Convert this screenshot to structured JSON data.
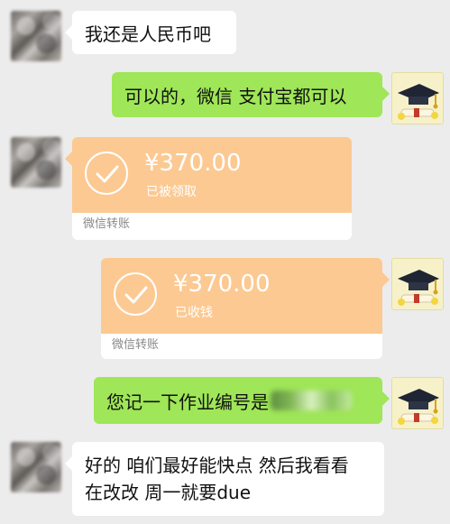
{
  "messages": [
    {
      "side": "left",
      "type": "text",
      "text": "我还是人民币吧"
    },
    {
      "side": "right",
      "type": "text",
      "text": "可以的，微信 支付宝都可以"
    },
    {
      "side": "left",
      "type": "transfer",
      "amount": "¥370.00",
      "status": "已被领取",
      "footer": "微信转账"
    },
    {
      "side": "right",
      "type": "transfer",
      "amount": "¥370.00",
      "status": "已收钱",
      "footer": "微信转账"
    },
    {
      "side": "right",
      "type": "text",
      "text": "您记一下作业编号是"
    },
    {
      "side": "left",
      "type": "text",
      "line1": "好的 咱们最好能快点 然后我看看",
      "line2": "在改改 周一就要due"
    }
  ],
  "colors": {
    "background": "#ececec",
    "green_bubble": "#9fe658",
    "white_bubble": "#ffffff",
    "transfer_orange": "#fcc992"
  },
  "icons": {
    "received": "check-circle-icon",
    "avatar_right": "graduation-cap-icon",
    "avatar_left": "blurred-photo"
  }
}
